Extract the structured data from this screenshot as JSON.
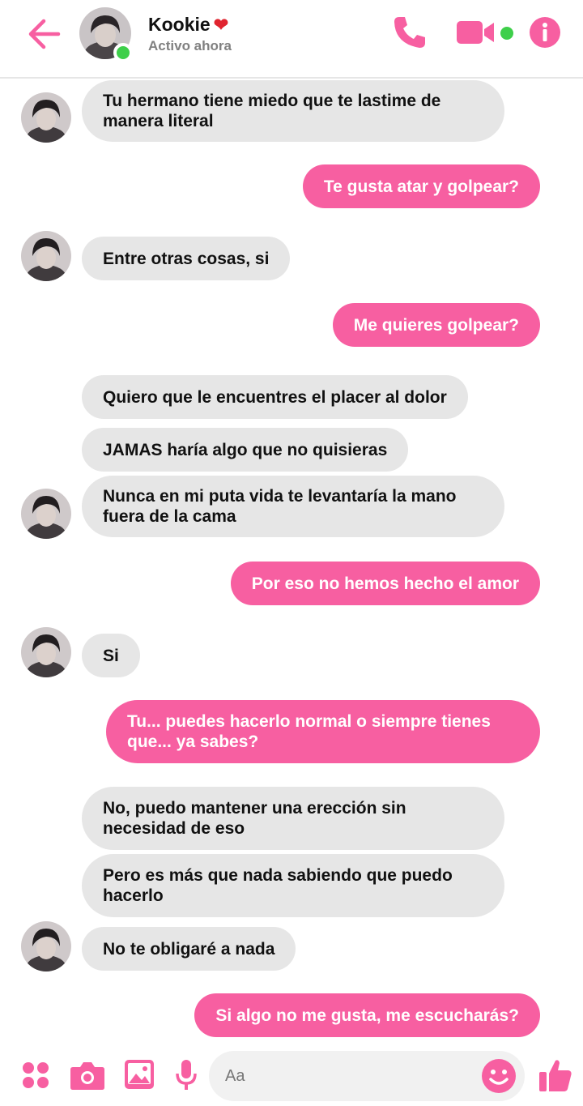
{
  "header": {
    "name": "Kookie",
    "heart": "❤",
    "status": "Activo ahora"
  },
  "colors": {
    "accent": "#f75fa1",
    "incoming_bubble": "#e6e6e6",
    "online": "#3ecf4a"
  },
  "messages": [
    {
      "side": "in",
      "text": "Tu hermano tiene miedo que te lastime de manera literal"
    },
    {
      "side": "out",
      "text": "Te gusta atar y golpear?"
    },
    {
      "side": "in",
      "text": "Entre otras cosas, si"
    },
    {
      "side": "out",
      "text": "Me quieres golpear?"
    },
    {
      "side": "in",
      "text": "Quiero que le encuentres el placer al dolor"
    },
    {
      "side": "in",
      "text": "JAMAS haría algo que no quisieras"
    },
    {
      "side": "in",
      "text": "Nunca en mi puta vida te levantaría la mano fuera de la cama"
    },
    {
      "side": "out",
      "text": "Por eso no hemos hecho el amor"
    },
    {
      "side": "in",
      "text": "Si"
    },
    {
      "side": "out",
      "text": "Tu... puedes hacerlo normal o siempre tienes que... ya sabes?"
    },
    {
      "side": "in",
      "text": "No, puedo mantener una erección sin necesidad de eso"
    },
    {
      "side": "in",
      "text": "Pero es más que nada sabiendo que puedo hacerlo"
    },
    {
      "side": "in",
      "text": "No te obligaré a nada"
    },
    {
      "side": "out",
      "text": "Si algo no me gusta, me escucharás?"
    }
  ],
  "composer": {
    "placeholder": "Aa",
    "icons": [
      "apps-icon",
      "camera-icon",
      "gallery-icon",
      "microphone-icon",
      "emoji-icon",
      "thumbs-up-icon"
    ]
  }
}
